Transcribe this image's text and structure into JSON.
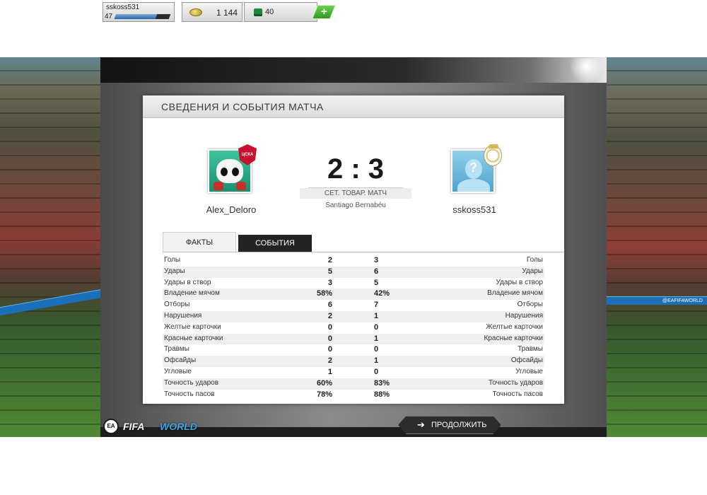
{
  "topbar": {
    "player_name": "sskoss531",
    "player_level": "47",
    "xp_progress": 0.75,
    "coins_icon": "coins-icon",
    "coins": "1 144",
    "points_icon": "fifa-points-icon",
    "points": "40",
    "add_points_label": "+"
  },
  "panel": {
    "title": "СВЕДЕНИЯ И СОБЫТИЯ МАТЧА",
    "home": {
      "name": "Alex_Deloro",
      "badge": "ЦСКА"
    },
    "away": {
      "name": "sskoss531",
      "avatar_placeholder": "?"
    },
    "score": "2 : 3",
    "match_type": "СЕТ. ТОВАР. МАТЧ",
    "stadium": "Santiago Bernabéu"
  },
  "tabs": [
    {
      "label": "ФАКТЫ",
      "active": true
    },
    {
      "label": "СОБЫТИЯ",
      "active": false
    }
  ],
  "stats": [
    {
      "label": "Голы",
      "home": "2",
      "away": "3"
    },
    {
      "label": "Удары",
      "home": "5",
      "away": "6"
    },
    {
      "label": "Удары в створ",
      "home": "3",
      "away": "5"
    },
    {
      "label": "Владение мячом",
      "home": "58%",
      "away": "42%"
    },
    {
      "label": "Отборы",
      "home": "6",
      "away": "7"
    },
    {
      "label": "Нарушения",
      "home": "2",
      "away": "1"
    },
    {
      "label": "Желтые карточки",
      "home": "0",
      "away": "0"
    },
    {
      "label": "Красные карточки",
      "home": "0",
      "away": "1"
    },
    {
      "label": "Травмы",
      "home": "0",
      "away": "0"
    },
    {
      "label": "Офсайды",
      "home": "2",
      "away": "1"
    },
    {
      "label": "Угловые",
      "home": "1",
      "away": "0"
    },
    {
      "label": "Точность ударов",
      "home": "60%",
      "away": "83%"
    },
    {
      "label": "Точность пасов",
      "home": "78%",
      "away": "88%"
    }
  ],
  "footer": {
    "ea_logo": "EA SPORTS",
    "logo_part1": "FIFA",
    "logo_part2": "WORLD",
    "continue_label": "ПРОДОЛЖИТЬ",
    "continue_icon": "arrow-right-icon"
  },
  "stadium_ad": "@EAFIFAWORLD"
}
